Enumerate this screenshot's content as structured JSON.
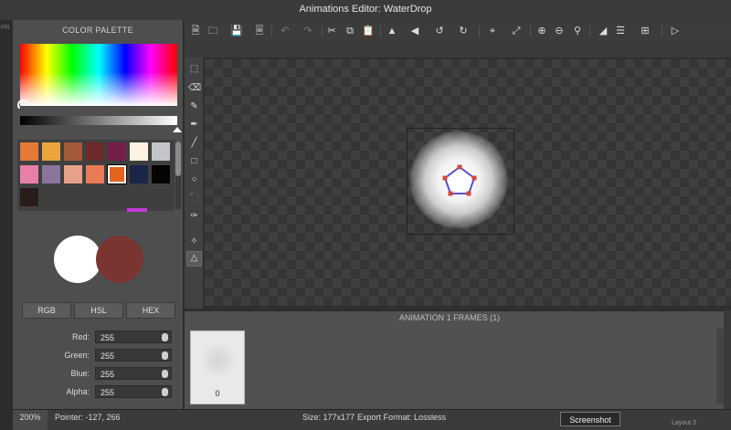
{
  "window": {
    "title": "Animations Editor: WaterDrop"
  },
  "background_text": {
    "left_pr": "PR",
    "right_text": "Layout 3"
  },
  "color_palette": {
    "title": "COLOR PALETTE",
    "swatches": [
      [
        "#e47a36",
        "#eba53b",
        "#a35a3a",
        "#6e2b2b",
        "#741e4a",
        "#fdf1e3",
        "#c3c5c8"
      ],
      [
        "#e680a7",
        "#8a759b",
        "#e7a18b",
        "#ea7a55",
        "#e3641f",
        "#1a2548",
        "#050505"
      ],
      [
        "#2a1c1a",
        "#3e3e3e",
        "#3e3e3e",
        "#3e3e3e",
        "#3e3e3e",
        "#3e3e3e",
        "#3e3e3e"
      ]
    ],
    "selected_swatch": "#e3641f",
    "primary_color": "#ffffff",
    "secondary_color": "#7a3533",
    "modes": [
      "RGB",
      "HSL",
      "HEX"
    ],
    "channels": [
      {
        "label": "Red:",
        "value": "255"
      },
      {
        "label": "Green:",
        "value": "255"
      },
      {
        "label": "Blue:",
        "value": "255"
      },
      {
        "label": "Alpha:",
        "value": "255"
      }
    ]
  },
  "toolbar": {
    "icons": [
      "new-file-icon",
      "open-folder-icon",
      "save-icon",
      "export-icon",
      "undo-icon",
      "redo-icon",
      "cut-icon",
      "copy-icon",
      "paste-icon",
      "flip-horizontal-icon",
      "flip-vertical-icon",
      "rotate-left-icon",
      "rotate-right-icon",
      "crop-icon",
      "resize-icon",
      "zoom-in-icon",
      "zoom-out-icon",
      "zoom-fit-icon",
      "color-adjust-icon",
      "layers-icon",
      "grid-icon",
      "play-icon"
    ]
  },
  "tools": [
    "selection-tool",
    "eraser-tool",
    "pencil-tool",
    "brush-tool",
    "line-tool",
    "rectangle-tool",
    "ellipse-tool",
    "fill-tool",
    "eyedropper-tool",
    "magic-wand-tool",
    "vertex-tool"
  ],
  "animation": {
    "title": "ANIMATION 1 FRAMES (1)",
    "frames": [
      {
        "label": "0"
      }
    ]
  },
  "status": {
    "zoom": "200%",
    "pointer": "Pointer: -127, 266",
    "size": "Size: 177x177",
    "format": "Export Format: Lossless"
  },
  "tooltip": {
    "text": "Screenshot"
  }
}
